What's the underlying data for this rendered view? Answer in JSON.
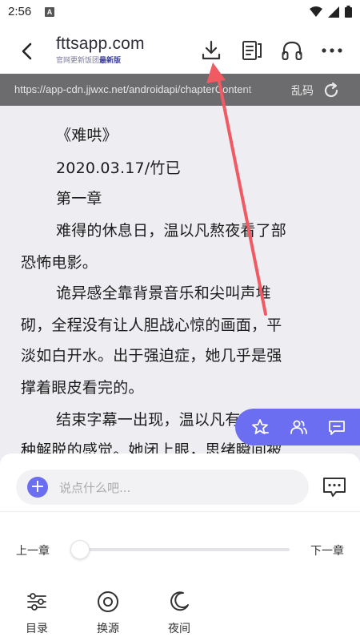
{
  "status_bar": {
    "time": "2:56",
    "notification_letter": "A"
  },
  "header": {
    "site_name": "fttsapp.com",
    "site_sub_prefix": "官网更新饭团",
    "site_sub_highlight": "最新版"
  },
  "url_bar": {
    "url": "https://app-cdn.jjwxc.net/androidapi/chapterContent",
    "mojibake_label": "乱码"
  },
  "content": {
    "lines": [
      "《难哄》",
      "2020.03.17/竹已",
      "第一章",
      "难得的休息日，温以凡熬夜看了部",
      "恐怖电影。",
      "诡异感全靠背景音乐和尖叫声堆",
      "砌，全程没有让人胆战心惊的画面，平",
      "淡如白开水。出于强迫症，她几乎是强",
      "撑着眼皮看完的。",
      "结束字幕一出现，温以凡有",
      "种解脱的感觉。她闭上眼，思绪瞬间被"
    ]
  },
  "comment": {
    "placeholder": "说点什么吧..."
  },
  "chapter_nav": {
    "prev": "上一章",
    "next": "下一章",
    "progress": 0
  },
  "bottom_nav": [
    {
      "label": "目录",
      "icon": "toc-sliders-icon"
    },
    {
      "label": "换源",
      "icon": "source-switch-icon"
    },
    {
      "label": "夜间",
      "icon": "moon-icon"
    }
  ],
  "colors": {
    "accent": "#6b6ef0",
    "annotation_arrow": "#f05a63"
  }
}
